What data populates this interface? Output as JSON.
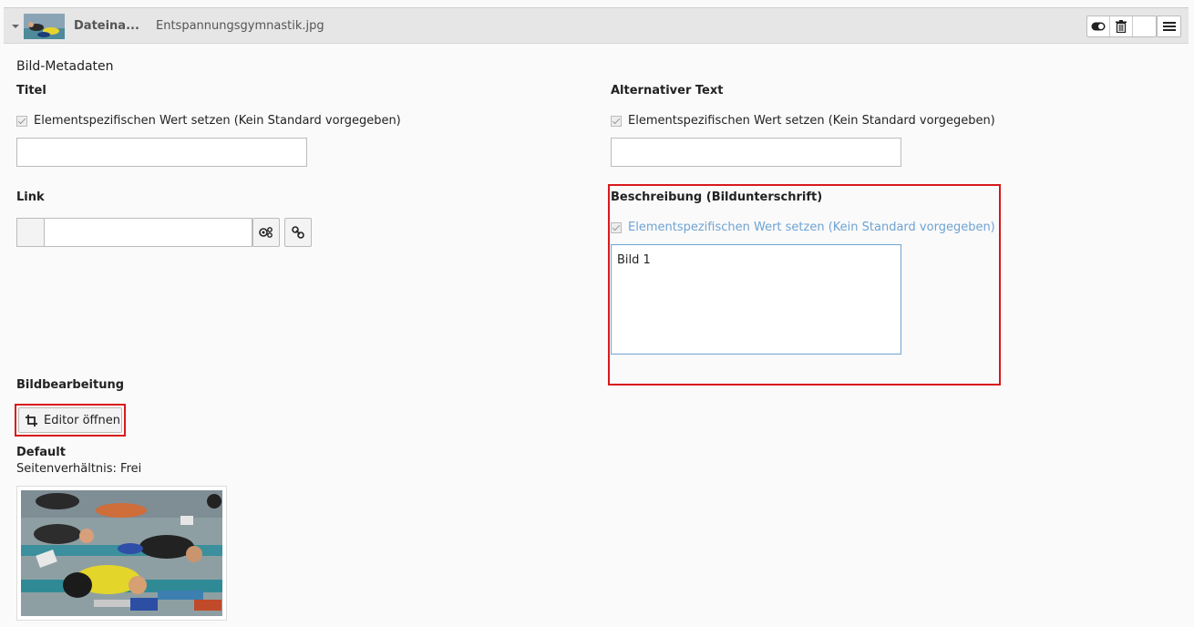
{
  "header": {
    "file_label": "Dateina...",
    "file_name": "Entspannungsgymnastik.jpg",
    "buttons": {
      "toggle_icon": "toggle-icon",
      "delete_icon": "trash-icon",
      "menu_icon": "menu-icon"
    }
  },
  "section": {
    "title": "Bild-Metadaten"
  },
  "fields": {
    "title": {
      "label": "Titel",
      "checkbox_label": "Elementspezifischen Wert setzen (Kein Standard vorgegeben)",
      "value": ""
    },
    "alt": {
      "label": "Alternativer Text",
      "checkbox_label": "Elementspezifischen Wert setzen (Kein Standard vorgegeben)",
      "value": ""
    },
    "link": {
      "label": "Link",
      "value": ""
    },
    "description": {
      "label": "Beschreibung (Bildunterschrift)",
      "checkbox_label": "Elementspezifischen Wert setzen (Kein Standard vorgegeben)",
      "value": "Bild 1"
    }
  },
  "image_editing": {
    "label": "Bildbearbeitung",
    "button_label": "Editor öffnen",
    "crop_name": "Default",
    "aspect_ratio": "Seitenverhältnis: Frei"
  },
  "colors": {
    "highlight_red": "#d8191c",
    "accent_blue": "#6fa3d3"
  }
}
